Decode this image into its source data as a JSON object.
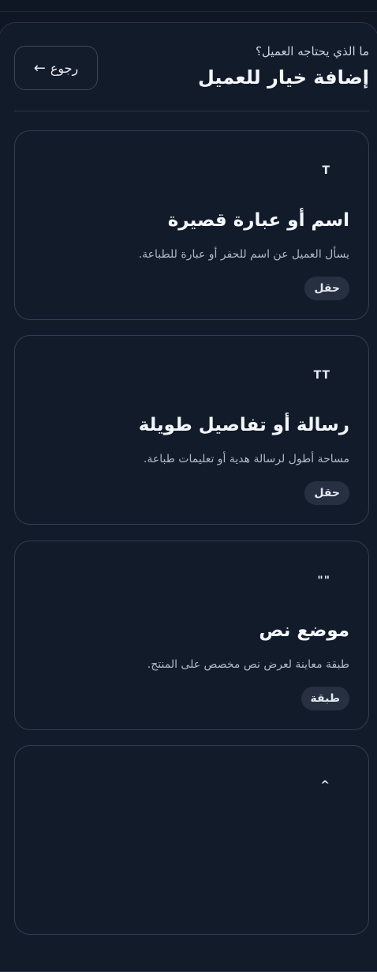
{
  "header": {
    "subtitle": "ما الذي يحتاجه العميل؟",
    "title": "إضافة خيار للعميل",
    "back_label": "رجوع",
    "back_arrow": "←"
  },
  "cards": [
    {
      "icon": "T",
      "icon_name": "text-t-icon",
      "title": "اسم أو عبارة قصيرة",
      "description": "يسأل العميل عن اسم للحفر أو عبارة للطباعة.",
      "badge": "حقل"
    },
    {
      "icon": "TT",
      "icon_name": "double-t-icon",
      "title": "رسالة أو تفاصيل طويلة",
      "description": "مساحة أطول لرسالة هدية أو تعليمات طباعة.",
      "badge": "حقل"
    },
    {
      "icon": "\"\"",
      "icon_name": "quote-icon",
      "title": "موضع نص",
      "description": "طبقة معاينة لعرض نص مخصص على المنتج.",
      "badge": "طبقة"
    },
    {
      "icon": "^",
      "icon_name": "caret-up-icon",
      "title": "",
      "description": "",
      "badge": ""
    }
  ]
}
